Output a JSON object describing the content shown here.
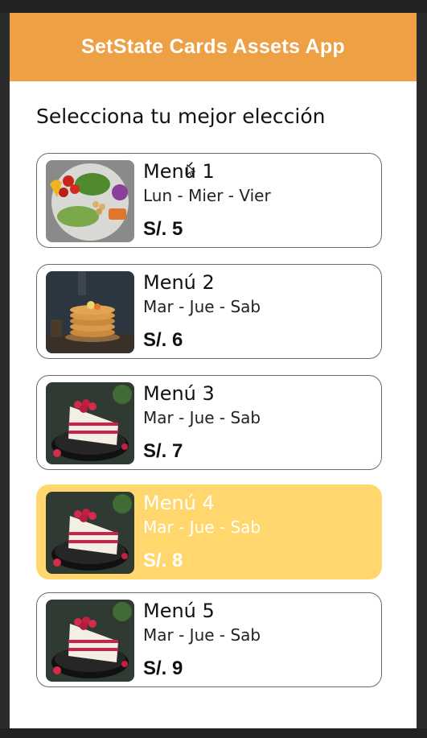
{
  "appbar": {
    "title": "SetState Cards Assets App",
    "color": "#eda044"
  },
  "heading": "Selecciona tu mejor elección",
  "selected_color": "#ffd76d",
  "menus": [
    {
      "name": "Menú 1",
      "days": "Lun - Mier - Vier",
      "price": "S/. 5",
      "image": "salad-bowl-image",
      "selected": false
    },
    {
      "name": "Menú 2",
      "days": "Mar - Jue - Sab",
      "price": "S/. 6",
      "image": "pancake-stack-image",
      "selected": false
    },
    {
      "name": "Menú 3",
      "days": "Mar - Jue - Sab",
      "price": "S/. 7",
      "image": "raspberry-cake-image",
      "selected": false
    },
    {
      "name": "Menú 4",
      "days": "Mar - Jue - Sab",
      "price": "S/. 8",
      "image": "raspberry-cake-image",
      "selected": true
    },
    {
      "name": "Menú 5",
      "days": "Mar - Jue - Sab",
      "price": "S/. 9",
      "image": "raspberry-cake-image",
      "selected": false
    }
  ]
}
